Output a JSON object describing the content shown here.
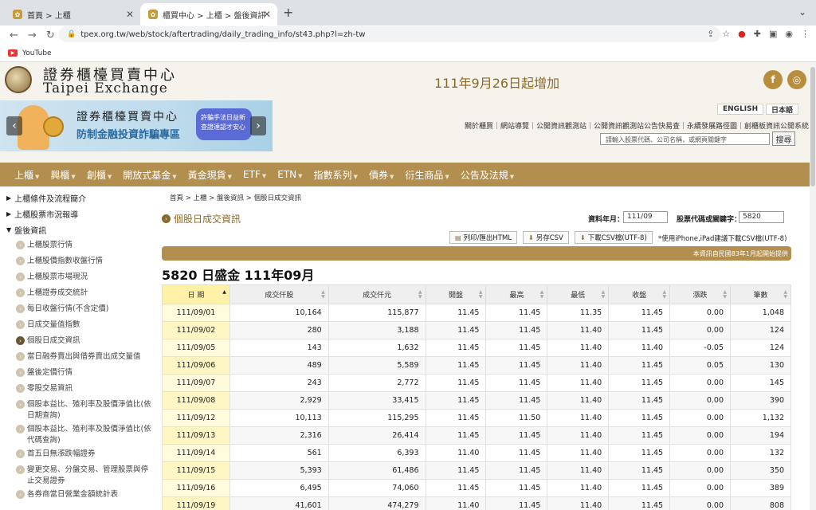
{
  "browser": {
    "tabs": [
      {
        "title": "首頁 > 上櫃"
      },
      {
        "title": "櫃買中心 > 上櫃 > 盤後資訊 > 個"
      }
    ],
    "url": "tpex.org.tw/web/stock/aftertrading/daily_trading_info/st43.php?l=zh-tw",
    "bookmark": "YouTube"
  },
  "header": {
    "logo_cn": "證券櫃檯買賣中心",
    "logo_en": "Taipei Exchange",
    "headline": "111年9月26日起增加"
  },
  "banner": {
    "title": "證券櫃檯買賣中心",
    "subtitle": "防制金融投資詐騙專區",
    "bubble": "許騙手法日益新 查證達認才安心"
  },
  "lang": {
    "english": "ENGLISH",
    "japanese": "日本語"
  },
  "toplinks": "關於櫃買｜網站導覽｜公開資訊觀測站｜公開資訊觀測站公告快易查｜永續發展路徑圖｜創櫃板資訊公開系統",
  "search": {
    "placeholder": "請輸入股票代碼、公司名稱，或網頁關鍵字",
    "button": "搜尋"
  },
  "mainnav": [
    "上櫃",
    "興櫃",
    "創櫃",
    "開放式基金",
    "黃金現貨",
    "ETF",
    "ETN",
    "指數系列",
    "債券",
    "衍生商品",
    "公告及法規"
  ],
  "sidebar": {
    "top": [
      "上櫃條件及流程簡介",
      "上櫃股票市況報導",
      "盤後資訊"
    ],
    "items": [
      "上櫃股票行情",
      "上櫃股價指數收盤行情",
      "上櫃股票市場現況",
      "上櫃證券成交統計",
      "每日收盤行情(不含定價)",
      "日成交量值指數",
      "個股日成交資訊",
      "當日融券賣出與借券賣出成交量值",
      "盤後定價行情",
      "零股交易資訊",
      "個股本益比、殖利率及股價淨值比(依日期查詢)",
      "個股本益比、殖利率及股價淨值比(依代碼查詢)",
      "首五日無漲跌幅證券",
      "變更交易、分盤交易、管理股票與停止交易證券",
      "各券商當日營業金額統計表"
    ]
  },
  "content": {
    "breadcrumb": "首頁 > 上櫃 > 盤後資訊 > 個股日成交資訊",
    "title": "個股日成交資訊",
    "query": {
      "ym_label": "資料年月：",
      "ym_value": "111/09",
      "code_label": "股票代碼或關鍵字：",
      "code_value": "5820"
    },
    "buttons": {
      "print": "列印/匯出HTML",
      "save": "另存CSV",
      "download": "下載CSV檔(UTF-8)"
    },
    "note": "*使用iPhone,iPad建議下載CSV檔(UTF-8)",
    "bar_text": "本資訊自民國83年1月起開始提供",
    "stock_title": "5820 日盛金  111年09月"
  },
  "table": {
    "headers": [
      "日 期",
      "成交仟股",
      "成交仟元",
      "開盤",
      "最高",
      "最低",
      "收盤",
      "漲跌",
      "筆數"
    ],
    "rows": [
      [
        "111/09/01",
        "10,164",
        "115,877",
        "11.45",
        "11.45",
        "11.35",
        "11.45",
        "0.00",
        "1,048"
      ],
      [
        "111/09/02",
        "280",
        "3,188",
        "11.45",
        "11.45",
        "11.40",
        "11.45",
        "0.00",
        "124"
      ],
      [
        "111/09/05",
        "143",
        "1,632",
        "11.45",
        "11.45",
        "11.40",
        "11.40",
        "-0.05",
        "124"
      ],
      [
        "111/09/06",
        "489",
        "5,589",
        "11.45",
        "11.45",
        "11.40",
        "11.45",
        "0.05",
        "130"
      ],
      [
        "111/09/07",
        "243",
        "2,772",
        "11.45",
        "11.45",
        "11.40",
        "11.45",
        "0.00",
        "145"
      ],
      [
        "111/09/08",
        "2,929",
        "33,415",
        "11.45",
        "11.45",
        "11.40",
        "11.45",
        "0.00",
        "390"
      ],
      [
        "111/09/12",
        "10,113",
        "115,295",
        "11.45",
        "11.50",
        "11.40",
        "11.45",
        "0.00",
        "1,132"
      ],
      [
        "111/09/13",
        "2,316",
        "26,414",
        "11.45",
        "11.45",
        "11.40",
        "11.45",
        "0.00",
        "194"
      ],
      [
        "111/09/14",
        "561",
        "6,393",
        "11.40",
        "11.45",
        "11.40",
        "11.45",
        "0.00",
        "132"
      ],
      [
        "111/09/15",
        "5,393",
        "61,486",
        "11.45",
        "11.45",
        "11.40",
        "11.45",
        "0.00",
        "350"
      ],
      [
        "111/09/16",
        "6,495",
        "74,060",
        "11.45",
        "11.45",
        "11.40",
        "11.45",
        "0.00",
        "389"
      ],
      [
        "111/09/19",
        "41,601",
        "474,279",
        "11.40",
        "11.45",
        "11.40",
        "11.45",
        "0.00",
        "808"
      ]
    ]
  }
}
